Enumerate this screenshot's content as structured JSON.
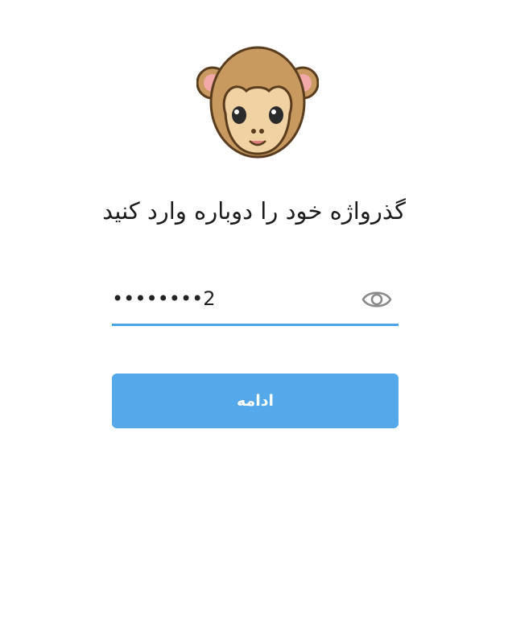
{
  "header": {
    "illustration_icon": "monkey-face-icon",
    "title": "گذرواژه خود را دوباره وارد کنید"
  },
  "password": {
    "value": "••••••••2",
    "toggle_icon": "eye-icon"
  },
  "actions": {
    "continue_label": "ادامه"
  },
  "colors": {
    "accent": "#4aa5e8",
    "button": "#55a8e9",
    "text": "#1c1c1c"
  }
}
